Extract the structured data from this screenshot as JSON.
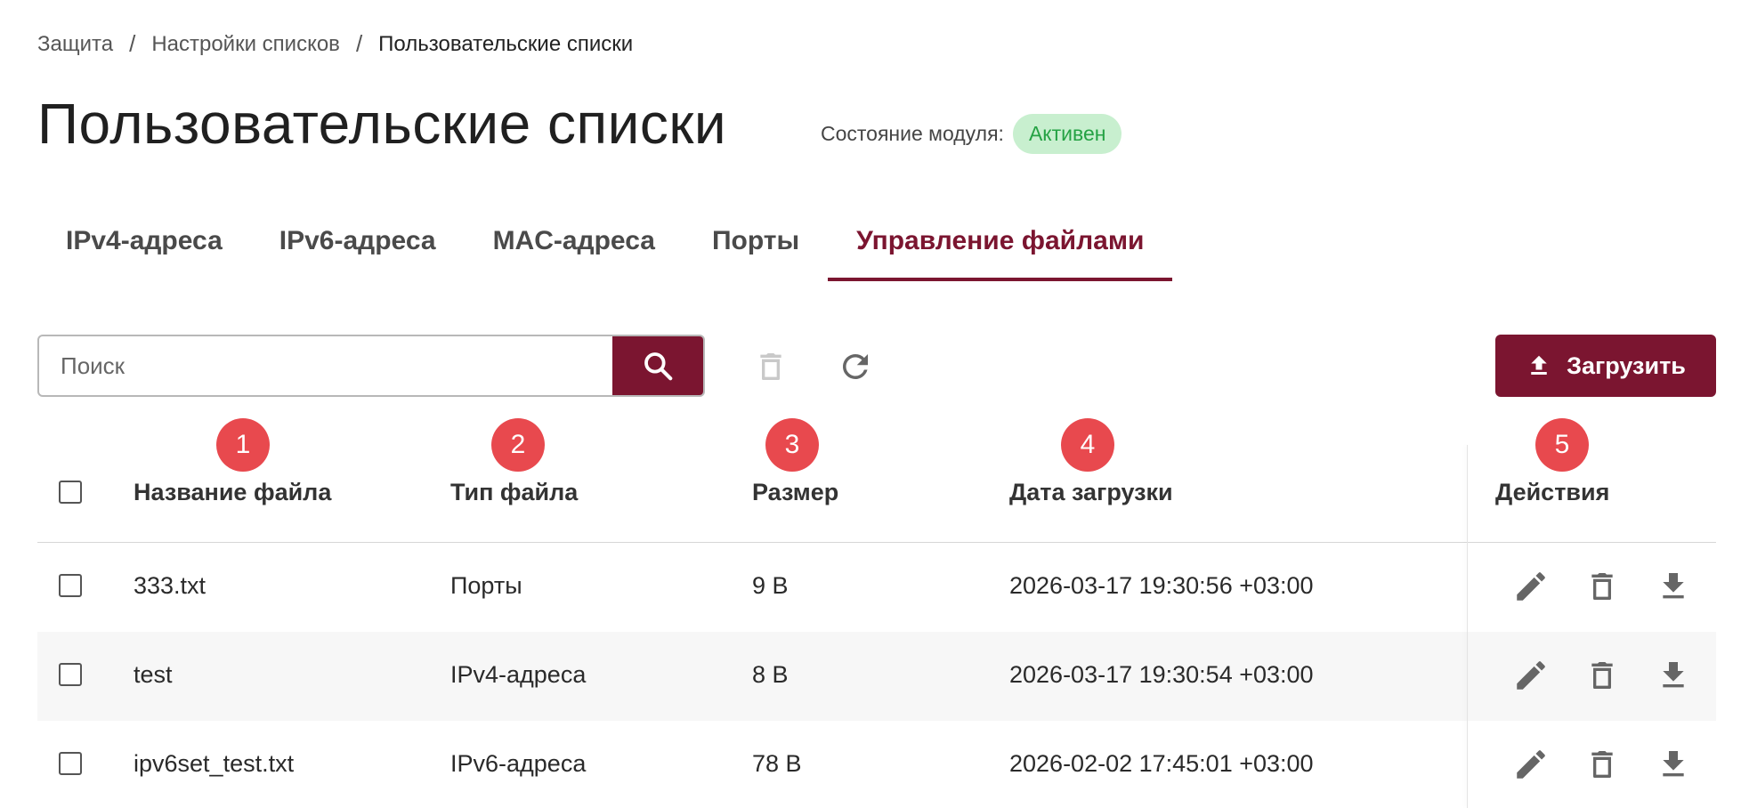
{
  "breadcrumb": {
    "items": [
      "Защита",
      "Настройки списков",
      "Пользовательские списки"
    ],
    "separator": "/"
  },
  "page": {
    "title": "Пользовательские списки",
    "status_label": "Состояние модуля:",
    "status_value": "Активен"
  },
  "tabs": [
    {
      "label": "IPv4-адреса",
      "active": false
    },
    {
      "label": "IPv6-адреса",
      "active": false
    },
    {
      "label": "MAC-адреса",
      "active": false
    },
    {
      "label": "Порты",
      "active": false
    },
    {
      "label": "Управление файлами",
      "active": true
    }
  ],
  "toolbar": {
    "search_placeholder": "Поиск",
    "upload_label": "Загрузить"
  },
  "markers": [
    "1",
    "2",
    "3",
    "4",
    "5"
  ],
  "table": {
    "headers": {
      "name": "Название файла",
      "type": "Тип файла",
      "size": "Размер",
      "date": "Дата загрузки",
      "actions": "Действия"
    },
    "rows": [
      {
        "name": "333.txt",
        "type": "Порты",
        "size": "9 B",
        "date": "2026-03-17 19:30:56 +03:00"
      },
      {
        "name": "test",
        "type": "IPv4-адреса",
        "size": "8 B",
        "date": "2026-03-17 19:30:54 +03:00"
      },
      {
        "name": "ipv6set_test.txt",
        "type": "IPv6-адреса",
        "size": "78 B",
        "date": "2026-02-02 17:45:01 +03:00"
      }
    ]
  },
  "colors": {
    "accent": "#7b1530",
    "status_bg": "#c8efcf",
    "status_text": "#25a244",
    "marker": "#e8494e",
    "row_alt": "#f7f7f7"
  },
  "icons": {
    "search": "search-icon",
    "delete": "trash-icon",
    "refresh": "refresh-icon",
    "upload": "upload-icon",
    "edit": "pencil-icon",
    "download": "download-icon"
  }
}
